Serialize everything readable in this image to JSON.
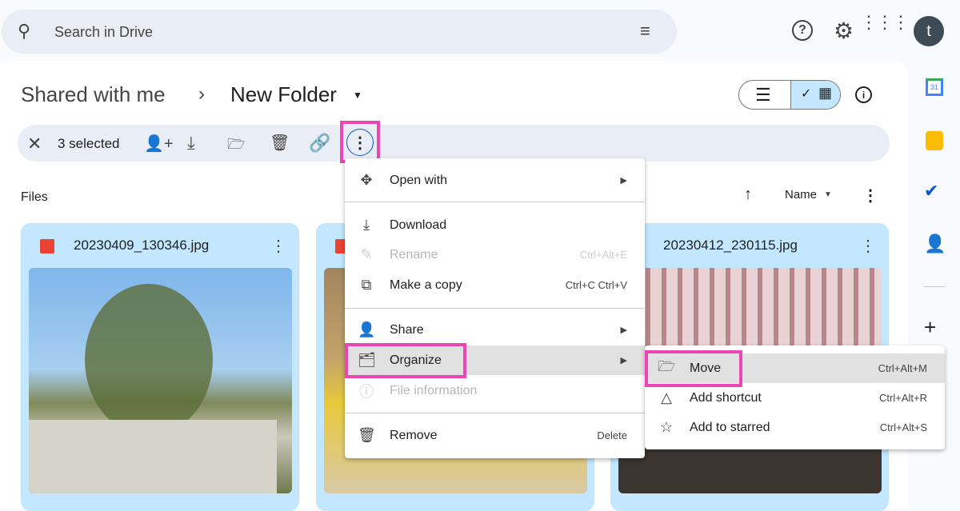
{
  "search": {
    "placeholder": "Search in Drive"
  },
  "header": {
    "avatar_letter": "t"
  },
  "breadcrumb": {
    "parent": "Shared with me",
    "current": "New Folder"
  },
  "selection": {
    "count_label": "3 selected"
  },
  "section": {
    "files_label": "Files",
    "sort_label": "Name"
  },
  "files": [
    {
      "name": "20230409_130346.jpg"
    },
    {
      "name": ""
    },
    {
      "name": "20230412_230115.jpg"
    }
  ],
  "context_menu": {
    "items": [
      {
        "label": "Open with",
        "icon": "open-with-icon",
        "submenu": true
      },
      {
        "label": "Download",
        "icon": "download-icon"
      },
      {
        "label": "Rename",
        "icon": "rename-icon",
        "shortcut": "Ctrl+Alt+E",
        "disabled": true
      },
      {
        "label": "Make a copy",
        "icon": "copy-icon",
        "shortcut": "Ctrl+C Ctrl+V"
      },
      {
        "label": "Share",
        "icon": "share-icon",
        "submenu": true
      },
      {
        "label": "Organize",
        "icon": "folder-open-icon",
        "submenu": true,
        "highlighted": true
      },
      {
        "label": "File information",
        "icon": "info-icon",
        "disabled": true
      },
      {
        "label": "Remove",
        "icon": "trash-icon",
        "shortcut": "Delete"
      }
    ]
  },
  "submenu": {
    "items": [
      {
        "label": "Move",
        "shortcut": "Ctrl+Alt+M",
        "highlighted": true
      },
      {
        "label": "Add shortcut",
        "shortcut": "Ctrl+Alt+R"
      },
      {
        "label": "Add to starred",
        "shortcut": "Ctrl+Alt+S"
      }
    ]
  },
  "colors": {
    "accent": "#c2e7ff",
    "highlight": "#ec45b4",
    "search_bg": "#e9eef6"
  }
}
